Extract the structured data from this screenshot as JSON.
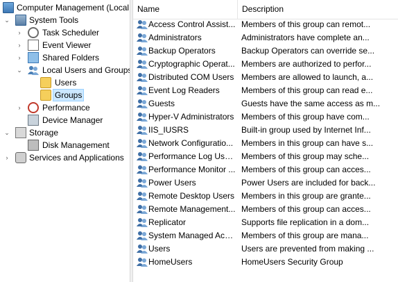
{
  "tree": {
    "root_label": "Computer Management (Local",
    "system_tools": "System Tools",
    "task_scheduler": "Task Scheduler",
    "event_viewer": "Event Viewer",
    "shared_folders": "Shared Folders",
    "local_users_groups": "Local Users and Groups",
    "users": "Users",
    "groups": "Groups",
    "performance": "Performance",
    "device_manager": "Device Manager",
    "storage": "Storage",
    "disk_management": "Disk Management",
    "services_apps": "Services and Applications"
  },
  "list": {
    "col_name": "Name",
    "col_description": "Description",
    "rows": [
      {
        "name": "Access Control Assist...",
        "desc": "Members of this group can remot..."
      },
      {
        "name": "Administrators",
        "desc": "Administrators have complete an..."
      },
      {
        "name": "Backup Operators",
        "desc": "Backup Operators can override se..."
      },
      {
        "name": "Cryptographic Operat...",
        "desc": "Members are authorized to perfor..."
      },
      {
        "name": "Distributed COM Users",
        "desc": "Members are allowed to launch, a..."
      },
      {
        "name": "Event Log Readers",
        "desc": "Members of this group can read e..."
      },
      {
        "name": "Guests",
        "desc": "Guests have the same access as m..."
      },
      {
        "name": "Hyper-V Administrators",
        "desc": "Members of this group have com..."
      },
      {
        "name": "IIS_IUSRS",
        "desc": "Built-in group used by Internet Inf..."
      },
      {
        "name": "Network Configuratio...",
        "desc": "Members in this group can have s..."
      },
      {
        "name": "Performance Log Users",
        "desc": "Members of this group may sche..."
      },
      {
        "name": "Performance Monitor ...",
        "desc": "Members of this group can acces..."
      },
      {
        "name": "Power Users",
        "desc": "Power Users are included for back..."
      },
      {
        "name": "Remote Desktop Users",
        "desc": "Members in this group are grante..."
      },
      {
        "name": "Remote Management...",
        "desc": "Members of this group can acces..."
      },
      {
        "name": "Replicator",
        "desc": "Supports file replication in a dom..."
      },
      {
        "name": "System Managed Acc...",
        "desc": "Members of this group are mana..."
      },
      {
        "name": "Users",
        "desc": "Users are prevented from making ..."
      },
      {
        "name": "HomeUsers",
        "desc": "HomeUsers Security Group"
      }
    ]
  },
  "icons": {
    "group_icon": "group-icon",
    "folder_icon": "folder-icon"
  },
  "colors": {
    "selection_bg": "#cce8ff",
    "selection_border": "#99d1ff"
  }
}
